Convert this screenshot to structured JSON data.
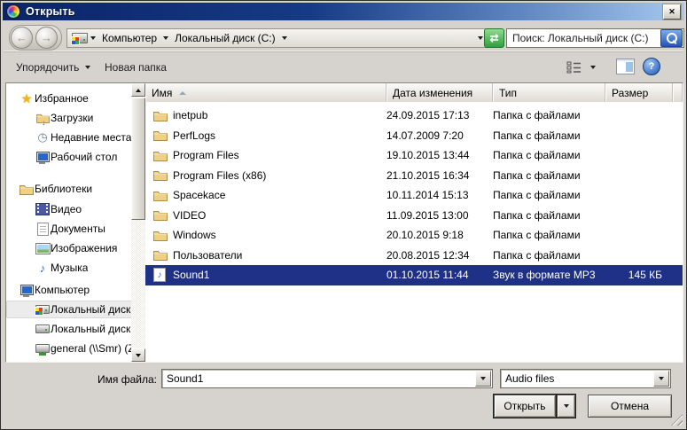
{
  "window": {
    "title": "Открыть"
  },
  "icons": {
    "close": "✕",
    "back": "←",
    "forward": "→",
    "refresh": "⇄",
    "help": "?",
    "star": "★",
    "note": "♪",
    "clock": "◷",
    "down_arrow": "↓"
  },
  "address": {
    "breadcrumb_root": "Компьютер",
    "breadcrumb_current": "Локальный диск (C:)",
    "search_text": "Поиск: Локальный диск (C:)"
  },
  "toolbar": {
    "organize": "Упорядочить",
    "new_folder": "Новая папка"
  },
  "sidebar": {
    "groups": [
      {
        "label": "Избранное",
        "items": [
          {
            "label": "Загрузки"
          },
          {
            "label": "Недавние места"
          },
          {
            "label": "Рабочий стол"
          }
        ]
      },
      {
        "label": "Библиотеки",
        "items": [
          {
            "label": "Видео"
          },
          {
            "label": "Документы"
          },
          {
            "label": "Изображения"
          },
          {
            "label": "Музыка"
          }
        ]
      },
      {
        "label": "Компьютер",
        "items": [
          {
            "label": "Локальный диск ("
          },
          {
            "label": "Локальный диск ("
          },
          {
            "label": "general (\\\\Smr) (Z:"
          }
        ]
      }
    ]
  },
  "list": {
    "columns": {
      "name": "Имя",
      "date": "Дата изменения",
      "type": "Тип",
      "size": "Размер"
    },
    "rows": [
      {
        "name": "inetpub",
        "date": "24.09.2015 17:13",
        "type": "Папка с файлами",
        "size": "",
        "icon": "folder"
      },
      {
        "name": "PerfLogs",
        "date": "14.07.2009 7:20",
        "type": "Папка с файлами",
        "size": "",
        "icon": "folder"
      },
      {
        "name": "Program Files",
        "date": "19.10.2015 13:44",
        "type": "Папка с файлами",
        "size": "",
        "icon": "folder"
      },
      {
        "name": "Program Files (x86)",
        "date": "21.10.2015 16:34",
        "type": "Папка с файлами",
        "size": "",
        "icon": "folder"
      },
      {
        "name": "Spacekace",
        "date": "10.11.2014 15:13",
        "type": "Папка с файлами",
        "size": "",
        "icon": "folder"
      },
      {
        "name": "VIDEO",
        "date": "11.09.2015 13:00",
        "type": "Папка с файлами",
        "size": "",
        "icon": "folder"
      },
      {
        "name": "Windows",
        "date": "20.10.2015 9:18",
        "type": "Папка с файлами",
        "size": "",
        "icon": "folder"
      },
      {
        "name": "Пользователи",
        "date": "20.08.2015 12:34",
        "type": "Папка с файлами",
        "size": "",
        "icon": "folder"
      },
      {
        "name": "Sound1",
        "date": "01.10.2015 11:44",
        "type": "Звук в формате MP3",
        "size": "145 КБ",
        "icon": "audio",
        "selected": true
      }
    ]
  },
  "footer": {
    "file_name_label": "Имя файла:",
    "file_name_value": "Sound1",
    "file_type_value": "Audio files",
    "open": "Открыть",
    "cancel": "Отмена"
  },
  "colors": {
    "selection": "#1e3186",
    "titlebar_left": "#0a2468",
    "titlebar_right": "#a6c8ef",
    "refresh_green": "#2f9e3f",
    "search_blue": "#2257b8"
  }
}
